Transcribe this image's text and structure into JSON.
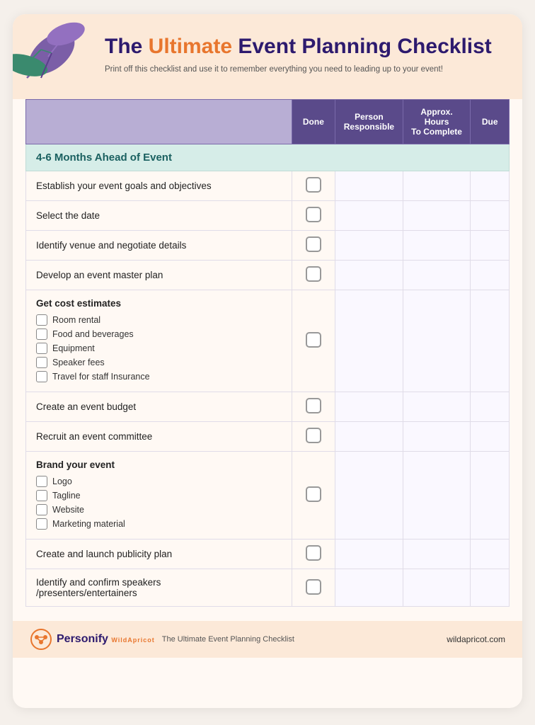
{
  "header": {
    "title_part1": "The ",
    "title_highlight": "Ultimate",
    "title_part2": " Event  Planning Checklist",
    "subtitle": "Print off this checklist and use it to remember everything you need to leading up to your event!"
  },
  "table": {
    "columns": {
      "done": "Done",
      "person": "Person\nResponsible",
      "hours": "Approx. Hours\nTo Complete",
      "due": "Due"
    },
    "section_label": "4-6 Months Ahead of Event",
    "rows": [
      {
        "id": "r1",
        "task": "Establish your event goals and objectives",
        "type": "simple"
      },
      {
        "id": "r2",
        "task": "Select the date",
        "type": "simple"
      },
      {
        "id": "r3",
        "task": "Identify venue and negotiate details",
        "type": "simple"
      },
      {
        "id": "r4",
        "task": "Develop an event master plan",
        "type": "simple"
      },
      {
        "id": "r5",
        "task": "Get cost estimates",
        "type": "with-sub",
        "sub_items": [
          "Room rental",
          "Food and beverages",
          "Equipment",
          "Speaker fees",
          "Travel for staff Insurance"
        ]
      },
      {
        "id": "r6",
        "task": "Create an event budget",
        "type": "simple"
      },
      {
        "id": "r7",
        "task": "Recruit an event committee",
        "type": "simple"
      },
      {
        "id": "r8",
        "task": "Brand your event",
        "type": "with-sub",
        "sub_items": [
          "Logo",
          "Tagline",
          "Website",
          "Marketing material"
        ]
      },
      {
        "id": "r9",
        "task": "Create and launch publicity plan",
        "type": "simple"
      },
      {
        "id": "r10",
        "task": "Identify and confirm speakers\n/presenters/entertainers",
        "type": "simple"
      }
    ]
  },
  "footer": {
    "brand_name": "Personify",
    "brand_sub": "WildApricot",
    "doc_title": "The Ultimate Event  Planning Checklist",
    "url": "wildapricot.com"
  }
}
